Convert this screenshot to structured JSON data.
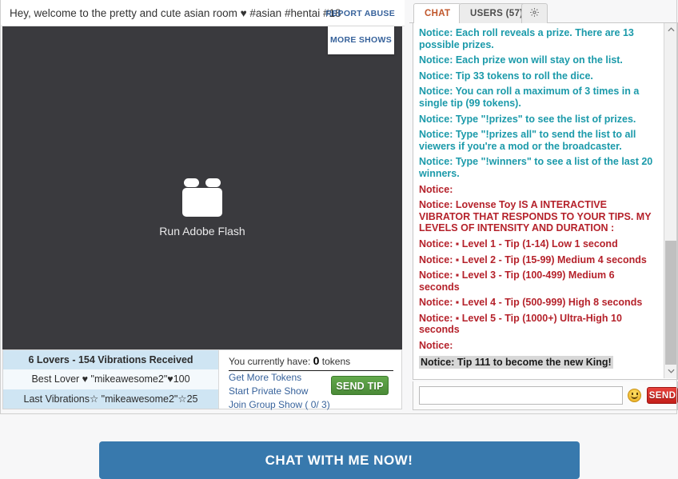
{
  "room": {
    "title": "Hey, welcome to the pretty and cute asian room ♥ #asian #hentai #18",
    "report_abuse_label": "REPORT ABUSE",
    "more_shows_label": "MORE SHOWS",
    "flash_placeholder_label": "Run Adobe Flash",
    "flash_icon": "flash-plugin-icon"
  },
  "info_panel": {
    "lovers_header": "6 Lovers - 154 Vibrations Received",
    "best_lover": "Best Lover ♥ \"mikeawesome2\"♥100",
    "last_vibrations": "Last Vibrations☆ \"mikeawesome2\"☆25",
    "token_prefix": "You currently have:",
    "token_count": "0",
    "token_suffix": "tokens",
    "get_more_tokens": "Get More Tokens",
    "start_private_show": "Start Private Show",
    "join_group_show": "Join Group Show ( 0/ 3)",
    "send_tip_label": "SEND TIP"
  },
  "chat": {
    "tabs": [
      {
        "label": "CHAT",
        "active": true
      },
      {
        "label": "USERS (57)",
        "active": false
      }
    ],
    "settings_tab_icon": "gear-icon",
    "messages": [
      {
        "text": "Notice: Each roll reveals a prize. There are 13 possible prizes.",
        "style": "teal"
      },
      {
        "text": "Notice: Each prize won will stay on the list.",
        "style": "teal"
      },
      {
        "text": "Notice: Tip 33 tokens to roll the dice.",
        "style": "teal"
      },
      {
        "text": "Notice: You can roll a maximum of 3 times in a single tip (99 tokens).",
        "style": "teal"
      },
      {
        "text": "Notice: Type \"!prizes\" to see the list of prizes.",
        "style": "teal"
      },
      {
        "text": "Notice: Type \"!prizes all\" to send the list to all viewers if you're a mod or the broadcaster.",
        "style": "teal"
      },
      {
        "text": "Notice: Type \"!winners\" to see a list of the last 20 winners.",
        "style": "teal"
      },
      {
        "text": "Notice:",
        "style": "red"
      },
      {
        "text": "Notice: Lovense Toy IS A INTERACTIVE VIBRATOR THAT RESPONDS TO YOUR TIPS. MY LEVELS OF INTENSITY AND DURATION :",
        "style": "red"
      },
      {
        "text": "Notice: ▪ Level 1 - Tip (1-14) Low 1 second",
        "style": "red"
      },
      {
        "text": "Notice: ▪ Level 2 - Tip (15-99) Medium 4 seconds",
        "style": "red"
      },
      {
        "text": "Notice: ▪ Level 3 - Tip (100-499) Medium 6 seconds",
        "style": "red"
      },
      {
        "text": "Notice: ▪ Level 4 - Tip (500-999) High 8 seconds",
        "style": "red"
      },
      {
        "text": "Notice: ▪ Level 5 - Tip (1000+) Ultra-High 10 seconds",
        "style": "red"
      },
      {
        "text": "Notice:",
        "style": "red"
      },
      {
        "text": "Notice: Tip 111 to become the new King!",
        "style": "king"
      }
    ],
    "input_value": "",
    "input_placeholder": "",
    "emoji_icon": "smiley-icon",
    "send_label": "SEND"
  },
  "cta": {
    "label": "CHAT WITH ME NOW!"
  },
  "colors": {
    "accent_blue": "#3879ad",
    "link_blue": "#37629b",
    "notice_teal": "#1b9aaa",
    "notice_red": "#b5222b",
    "tip_green": "#4a8a37",
    "send_red": "#c41f1a",
    "tab_active_text": "#c0562a",
    "stage_dark": "#3a3a3e",
    "lovers_shaded": "#cfe5f3"
  }
}
